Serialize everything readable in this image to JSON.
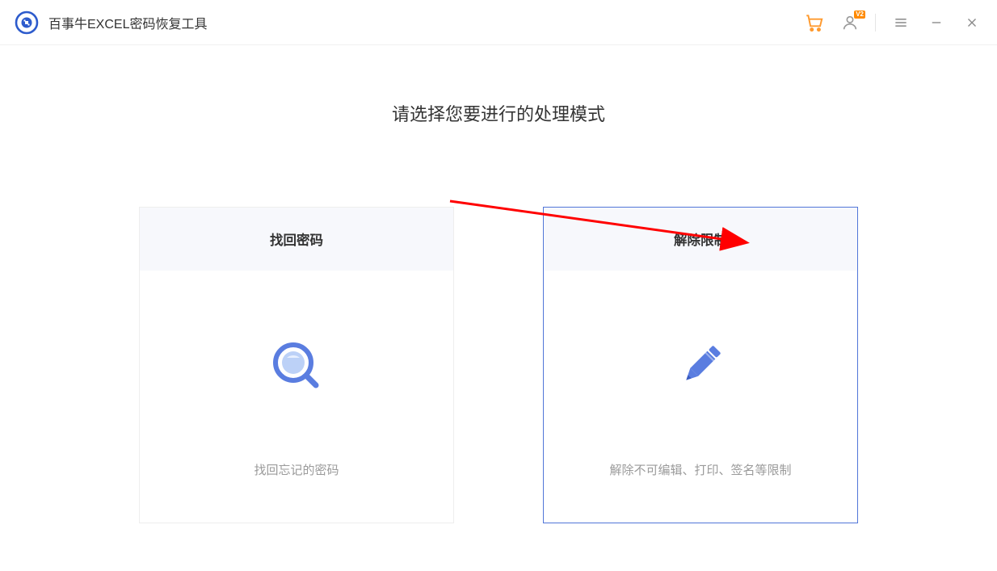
{
  "titlebar": {
    "app_title": "百事牛EXCEL密码恢复工具",
    "user_badge": "V2"
  },
  "main": {
    "heading": "请选择您要进行的处理模式",
    "cards": [
      {
        "title": "找回密码",
        "description": "找回忘记的密码",
        "selected": false
      },
      {
        "title": "解除限制",
        "description": "解除不可编辑、打印、签名等限制",
        "selected": true
      }
    ]
  }
}
